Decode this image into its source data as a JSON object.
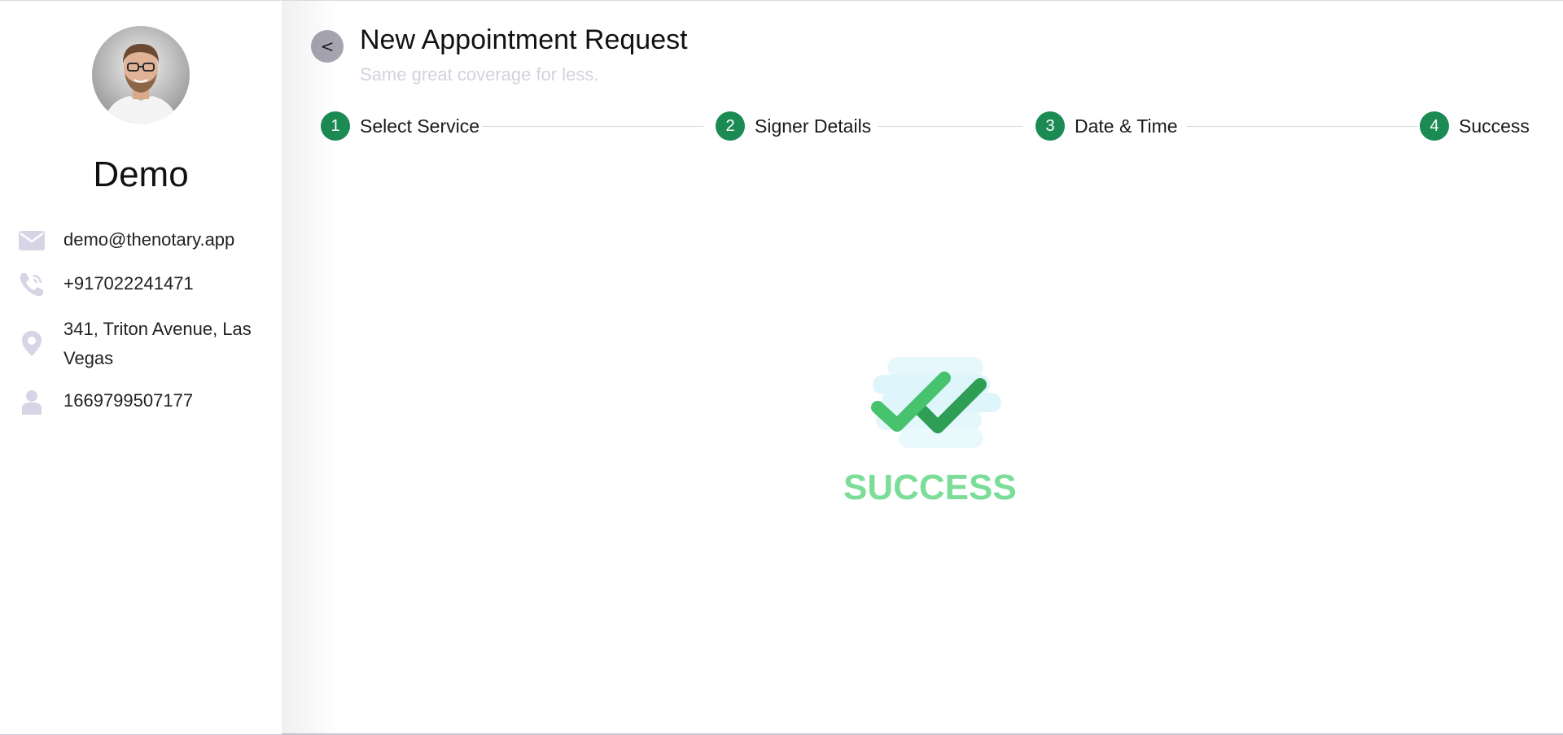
{
  "profile": {
    "name": "Demo",
    "email": "demo@thenotary.app",
    "phone": "+917022241471",
    "address": "341, Triton Avenue, Las Vegas",
    "user_id": "1669799507177"
  },
  "header": {
    "back_label": "<",
    "title": "New Appointment Request",
    "subtitle": "Same great coverage for less."
  },
  "stepper": {
    "steps": [
      {
        "number": "1",
        "label": "Select Service"
      },
      {
        "number": "2",
        "label": "Signer Details"
      },
      {
        "number": "3",
        "label": "Date & Time"
      },
      {
        "number": "4",
        "label": "Success"
      }
    ]
  },
  "result": {
    "status_text": "SUCCESS"
  },
  "icons": {
    "email": "envelope-icon",
    "phone": "phone-icon",
    "address": "map-pin-icon",
    "user": "user-icon",
    "success": "double-check-icon"
  },
  "colors": {
    "step_active": "#1b8a53",
    "success_text": "#7cdd99",
    "icon_muted": "#d7d4e6",
    "subtitle": "#d4d2df"
  }
}
